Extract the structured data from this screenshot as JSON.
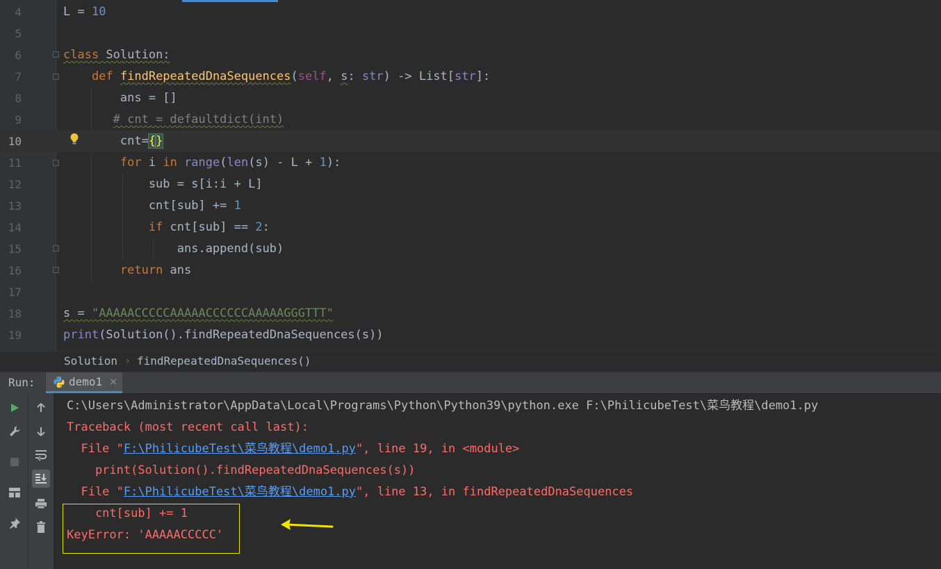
{
  "editor": {
    "lines": [
      {
        "num": "4"
      },
      {
        "num": "5"
      },
      {
        "num": "6"
      },
      {
        "num": "7"
      },
      {
        "num": "8"
      },
      {
        "num": "9"
      },
      {
        "num": "10"
      },
      {
        "num": "11"
      },
      {
        "num": "12"
      },
      {
        "num": "13"
      },
      {
        "num": "14"
      },
      {
        "num": "15"
      },
      {
        "num": "16"
      },
      {
        "num": "17"
      },
      {
        "num": "18"
      },
      {
        "num": "19"
      }
    ],
    "current_line": "10",
    "t": {
      "l4_a": "L = ",
      "l4_b": "10",
      "l6_a": "class",
      "l6_b": " Solution:",
      "l7_a": "    def ",
      "l7_b": "findRepeatedDnaSequences",
      "l7_c": "(",
      "l7_d": "self",
      "l7_e": ", ",
      "l7_f": "s",
      "l7_g": ": ",
      "l7_h": "str",
      "l7_i": ") -> List[",
      "l7_j": "str",
      "l7_k": "]:",
      "l8_a": "        ans = []",
      "l9_a": "       ",
      "l9_b": "# cnt = defaultdict(int)",
      "l10_a": "        cnt=",
      "l10_b": "{",
      "l10_c": "}",
      "l11_a": "        ",
      "l11_b": "for",
      "l11_c": " i ",
      "l11_d": "in",
      "l11_e": " ",
      "l11_f": "range",
      "l11_g": "(",
      "l11_h": "len",
      "l11_i": "(s) - L + ",
      "l11_j": "1",
      "l11_k": "):",
      "l12_a": "            sub = s[i:i + L]",
      "l13_a": "            cnt[sub] += ",
      "l13_b": "1",
      "l14_a": "            ",
      "l14_b": "if",
      "l14_c": " cnt[sub] == ",
      "l14_d": "2",
      "l14_e": ":",
      "l15_a": "                ans.append(sub)",
      "l16_a": "        ",
      "l16_b": "return",
      "l16_c": " ans",
      "l18_a": "s = ",
      "l18_b": "\"AAAAACCCCCAAAAACCCCCCAAAAAGGGTTT\"",
      "l19_a": "print",
      "l19_b": "(Solution().findRepeatedDnaSequences(s))"
    }
  },
  "breadcrumb": {
    "item1": "Solution",
    "sep": "›",
    "item2": "findRepeatedDnaSequences()"
  },
  "run": {
    "label": "Run:",
    "tab_label": "demo1",
    "tab_close": "×",
    "console": {
      "cmd": "C:\\Users\\Administrator\\AppData\\Local\\Programs\\Python\\Python39\\python.exe F:\\PhilicubeTest\\菜鸟教程\\demo1.py",
      "traceback": "Traceback (most recent call last):",
      "file_prefix": "  File \"",
      "file_link": "F:\\PhilicubeTest\\菜鸟教程\\demo1.py",
      "file1_suffix": "\", line 19, in <module>",
      "file1_code": "    print(Solution().findRepeatedDnaSequences(s))",
      "file2_suffix": "\", line 13, in findRepeatedDnaSequences",
      "file2_code": "    cnt[sub] += 1",
      "error": "KeyError: 'AAAAACCCCC'"
    }
  },
  "annotation_color": "#e9e400",
  "icons": {
    "left_toolbar": [
      "play-icon",
      "wrench-icon",
      "stop-icon",
      "layout-icon",
      "pin-icon"
    ],
    "right_toolbar": [
      "arrow-up-icon",
      "arrow-down-icon",
      "soft-wrap-icon",
      "scroll-to-end-icon",
      "print-icon",
      "trash-icon"
    ]
  }
}
